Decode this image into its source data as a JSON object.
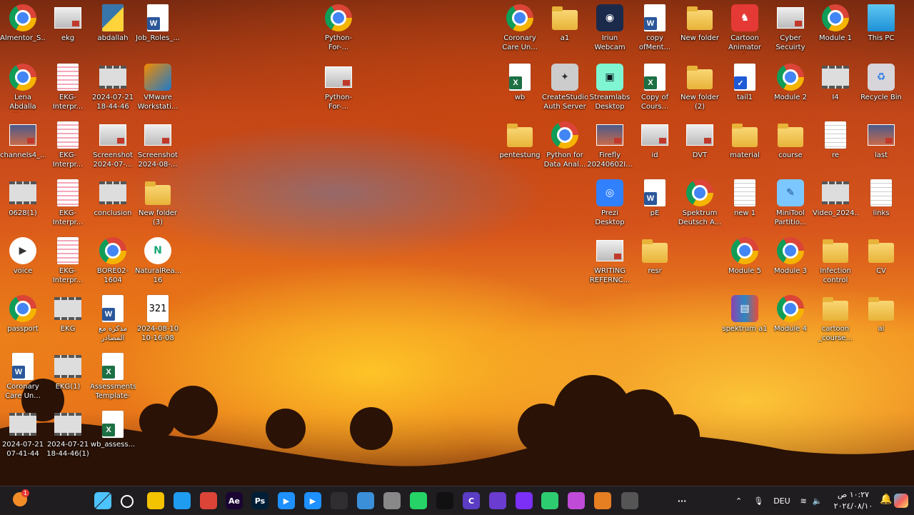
{
  "desktop": {
    "icons": [
      {
        "label": "Almentor_S...",
        "kind": "chrome"
      },
      {
        "label": "ekg",
        "kind": "thumb"
      },
      {
        "label": "abdallah",
        "kind": "python"
      },
      {
        "label": "Job_Roles_...",
        "kind": "word"
      },
      {
        "label": "Python-For-...",
        "kind": "chrome"
      },
      {
        "label": "Python-For-...",
        "kind": "thumb"
      },
      {
        "label": "Lena Abdalla\nHsam Abda...",
        "kind": "chrome"
      },
      {
        "label": "EKG-Interpr...",
        "kind": "doc"
      },
      {
        "label": "2024-07-21\n18-44-46",
        "kind": "film"
      },
      {
        "label": "VMware\nWorkstati...",
        "kind": "vmware"
      },
      {
        "label": "channels4_...",
        "kind": "photo"
      },
      {
        "label": "EKG-Interpr...",
        "kind": "doc"
      },
      {
        "label": "Screenshot\n2024-07-...",
        "kind": "thumb"
      },
      {
        "label": "Screenshot\n2024-08-...",
        "kind": "thumb"
      },
      {
        "label": "0628(1)",
        "kind": "film"
      },
      {
        "label": "EKG-Interpr...",
        "kind": "doc"
      },
      {
        "label": "conclusion",
        "kind": "film"
      },
      {
        "label": "New folder\n(3)",
        "kind": "folder"
      },
      {
        "label": "voice",
        "kind": "media"
      },
      {
        "label": "EKG-Interpr...",
        "kind": "doc"
      },
      {
        "label": "BORE02-1604",
        "kind": "chrome"
      },
      {
        "label": "NaturalRea...\n16",
        "kind": "natural"
      },
      {
        "label": "passport",
        "kind": "chrome"
      },
      {
        "label": "EKG",
        "kind": "film"
      },
      {
        "label": "مذكرة مع\nالمصادر",
        "kind": "word"
      },
      {
        "label": "2024-08-10\n10-16-08",
        "kind": "calendar"
      },
      {
        "label": "Coronary\nCare Un...",
        "kind": "word"
      },
      {
        "label": "EKG(1)",
        "kind": "film"
      },
      {
        "label": "Assessments\nTemplate-",
        "kind": "excel"
      },
      {
        "label": "2024-07-21\n07-41-44",
        "kind": "film"
      },
      {
        "label": "2024-07-21\n18-44-46(1)",
        "kind": "film"
      },
      {
        "label": "wb_assess...",
        "kind": "excel"
      },
      {
        "label": "Coronary\nCare Un...",
        "kind": "chrome"
      },
      {
        "label": "a1",
        "kind": "folder"
      },
      {
        "label": "Iriun Webcam",
        "kind": "iriun"
      },
      {
        "label": "copy\nofMent...",
        "kind": "word"
      },
      {
        "label": "New folder",
        "kind": "folder"
      },
      {
        "label": "Cartoon\nAnimator v4...",
        "kind": "cartoon"
      },
      {
        "label": "Cyber\nSecuirty",
        "kind": "thumb"
      },
      {
        "label": "Module 1",
        "kind": "chrome"
      },
      {
        "label": "This PC",
        "kind": "pc"
      },
      {
        "label": "wb",
        "kind": "excel"
      },
      {
        "label": "CreateStudio\nAuth Server",
        "kind": "createstudio"
      },
      {
        "label": "Streamlabs\nDesktop",
        "kind": "streamlabs"
      },
      {
        "label": "Copy of\nCours...",
        "kind": "excel"
      },
      {
        "label": "New folder\n(2)",
        "kind": "folder"
      },
      {
        "label": "tail1",
        "kind": "check"
      },
      {
        "label": "Module 2",
        "kind": "chrome"
      },
      {
        "label": "I4",
        "kind": "film"
      },
      {
        "label": "Recycle Bin",
        "kind": "recycle"
      },
      {
        "label": "pentestung",
        "kind": "folder"
      },
      {
        "label": "Python for\nData Anal...",
        "kind": "chrome"
      },
      {
        "label": "Firefly\n20240602I...",
        "kind": "photo"
      },
      {
        "label": "id",
        "kind": "thumb"
      },
      {
        "label": "DVT",
        "kind": "thumb"
      },
      {
        "label": "material",
        "kind": "folder"
      },
      {
        "label": "course",
        "kind": "folder"
      },
      {
        "label": "re",
        "kind": "doclines"
      },
      {
        "label": "last",
        "kind": "photo"
      },
      {
        "label": "Prezi Desktop",
        "kind": "prezi"
      },
      {
        "label": "pE",
        "kind": "word"
      },
      {
        "label": "Spektrum\nDeutsch A...",
        "kind": "chrome"
      },
      {
        "label": "new 1",
        "kind": "doclines"
      },
      {
        "label": "MiniTool\nPartitio...",
        "kind": "minitool"
      },
      {
        "label": "Video_2024...",
        "kind": "film"
      },
      {
        "label": "links",
        "kind": "doclines"
      },
      {
        "label": "WRITING\nREFERNC...",
        "kind": "thumb"
      },
      {
        "label": "resr",
        "kind": "folder"
      },
      {
        "label": "Module 5",
        "kind": "chrome"
      },
      {
        "label": "Module 3",
        "kind": "chrome"
      },
      {
        "label": "Infection\ncontrol",
        "kind": "folder"
      },
      {
        "label": "CV",
        "kind": "folder"
      },
      {
        "label": "spektrum a1",
        "kind": "winrar"
      },
      {
        "label": "Module 4",
        "kind": "chrome"
      },
      {
        "label": "cartoon\n_course...",
        "kind": "folder"
      },
      {
        "label": "ai",
        "kind": "folder"
      }
    ]
  },
  "taskbar": {
    "notification_count": "1",
    "apps": [
      {
        "name": "start",
        "text": ""
      },
      {
        "name": "search",
        "text": ""
      },
      {
        "name": "file-explorer",
        "text": ""
      },
      {
        "name": "edge",
        "text": ""
      },
      {
        "name": "chrome",
        "text": ""
      },
      {
        "name": "after-effects",
        "text": "Ae"
      },
      {
        "name": "photoshop",
        "text": "Ps"
      },
      {
        "name": "media-player",
        "text": "▶"
      },
      {
        "name": "media-player-2",
        "text": "▶"
      },
      {
        "name": "obs",
        "text": ""
      },
      {
        "name": "window-app",
        "text": ""
      },
      {
        "name": "usb",
        "text": ""
      },
      {
        "name": "whatsapp",
        "text": ""
      },
      {
        "name": "capcut",
        "text": ""
      },
      {
        "name": "app-c",
        "text": "C"
      },
      {
        "name": "app-purple",
        "text": ""
      },
      {
        "name": "app-star",
        "text": ""
      },
      {
        "name": "app-globe",
        "text": ""
      },
      {
        "name": "copilot",
        "text": ""
      },
      {
        "name": "app-bag",
        "text": ""
      },
      {
        "name": "app-red",
        "text": ""
      },
      {
        "name": "more",
        "text": "···"
      }
    ],
    "language": "DEU",
    "time": "١٠:٢٧ ص",
    "date": "٢٠٢٤/٠٨/١٠"
  }
}
